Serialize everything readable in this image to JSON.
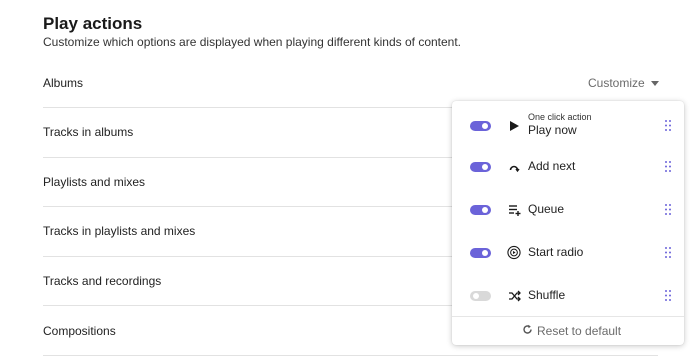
{
  "section": {
    "title": "Play actions",
    "description": "Customize which options are displayed when playing different kinds of content."
  },
  "rows": [
    {
      "label": "Albums"
    },
    {
      "label": "Tracks in albums"
    },
    {
      "label": "Playlists and mixes"
    },
    {
      "label": "Tracks in playlists and mixes"
    },
    {
      "label": "Tracks and recordings"
    },
    {
      "label": "Compositions"
    }
  ],
  "customize": {
    "label": "Customize",
    "icon": "caret-down-icon"
  },
  "popover": {
    "items": [
      {
        "sublabel": "One click action",
        "label": "Play now",
        "icon": "play-icon",
        "enabled": true
      },
      {
        "label": "Add next",
        "icon": "add-next-icon",
        "enabled": true
      },
      {
        "label": "Queue",
        "icon": "queue-add-icon",
        "enabled": true
      },
      {
        "label": "Start radio",
        "icon": "radio-icon",
        "enabled": true
      },
      {
        "label": "Shuffle",
        "icon": "shuffle-icon",
        "enabled": false
      }
    ],
    "reset_label": "Reset to default"
  },
  "colors": {
    "accent": "#6b63d9",
    "toggle_off": "#d9d9d9",
    "muted_text": "#6b6b6b",
    "divider": "#e2e2e2"
  }
}
